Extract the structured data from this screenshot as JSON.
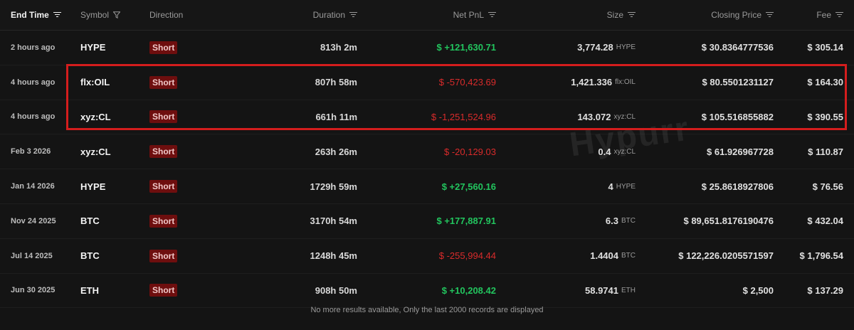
{
  "headers": {
    "end_time": "End Time",
    "symbol": "Symbol",
    "direction": "Direction",
    "duration": "Duration",
    "net_pnl": "Net PnL",
    "size": "Size",
    "closing_price": "Closing Price",
    "fee": "Fee"
  },
  "rows": [
    {
      "time": "2 hours ago",
      "symbol": "HYPE",
      "direction": "Short",
      "duration": "813h 2m",
      "pnl": "$ +121,630.71",
      "pnl_sign": "pos",
      "size": "3,774.28",
      "unit": "HYPE",
      "price": "$ 30.8364777536",
      "fee": "$ 305.14"
    },
    {
      "time": "4 hours ago",
      "symbol": "flx:OIL",
      "direction": "Short",
      "duration": "807h 58m",
      "pnl": "$ -570,423.69",
      "pnl_sign": "neg",
      "size": "1,421.336",
      "unit": "flx:OIL",
      "price": "$ 80.5501231127",
      "fee": "$ 164.30"
    },
    {
      "time": "4 hours ago",
      "symbol": "xyz:CL",
      "direction": "Short",
      "duration": "661h 11m",
      "pnl": "$ -1,251,524.96",
      "pnl_sign": "neg",
      "size": "143.072",
      "unit": "xyz:CL",
      "price": "$ 105.516855882",
      "fee": "$ 390.55"
    },
    {
      "time": "Feb 3 2026",
      "symbol": "xyz:CL",
      "direction": "Short",
      "duration": "263h 26m",
      "pnl": "$ -20,129.03",
      "pnl_sign": "neg",
      "size": "0.4",
      "unit": "xyz:CL",
      "price": "$ 61.926967728",
      "fee": "$ 110.87"
    },
    {
      "time": "Jan 14 2026",
      "symbol": "HYPE",
      "direction": "Short",
      "duration": "1729h 59m",
      "pnl": "$ +27,560.16",
      "pnl_sign": "pos",
      "size": "4",
      "unit": "HYPE",
      "price": "$ 25.8618927806",
      "fee": "$ 76.56"
    },
    {
      "time": "Nov 24 2025",
      "symbol": "BTC",
      "direction": "Short",
      "duration": "3170h 54m",
      "pnl": "$ +177,887.91",
      "pnl_sign": "pos",
      "size": "6.3",
      "unit": "BTC",
      "price": "$ 89,651.8176190476",
      "fee": "$ 432.04"
    },
    {
      "time": "Jul 14 2025",
      "symbol": "BTC",
      "direction": "Short",
      "duration": "1248h 45m",
      "pnl": "$ -255,994.44",
      "pnl_sign": "neg",
      "size": "1.4404",
      "unit": "BTC",
      "price": "$ 122,226.0205571597",
      "fee": "$ 1,796.54"
    },
    {
      "time": "Jun 30 2025",
      "symbol": "ETH",
      "direction": "Short",
      "duration": "908h 50m",
      "pnl": "$ +10,208.42",
      "pnl_sign": "pos",
      "size": "58.9741",
      "unit": "ETH",
      "price": "$ 2,500",
      "fee": "$ 137.29"
    }
  ],
  "footer": "No more results available, Only the last 2000 records are displayed",
  "watermark": "Hypurr",
  "colors": {
    "positive": "#22c55e",
    "negative": "#d92b2b",
    "badge_bg": "#6e0e0e",
    "highlight": "#d41d1d"
  }
}
